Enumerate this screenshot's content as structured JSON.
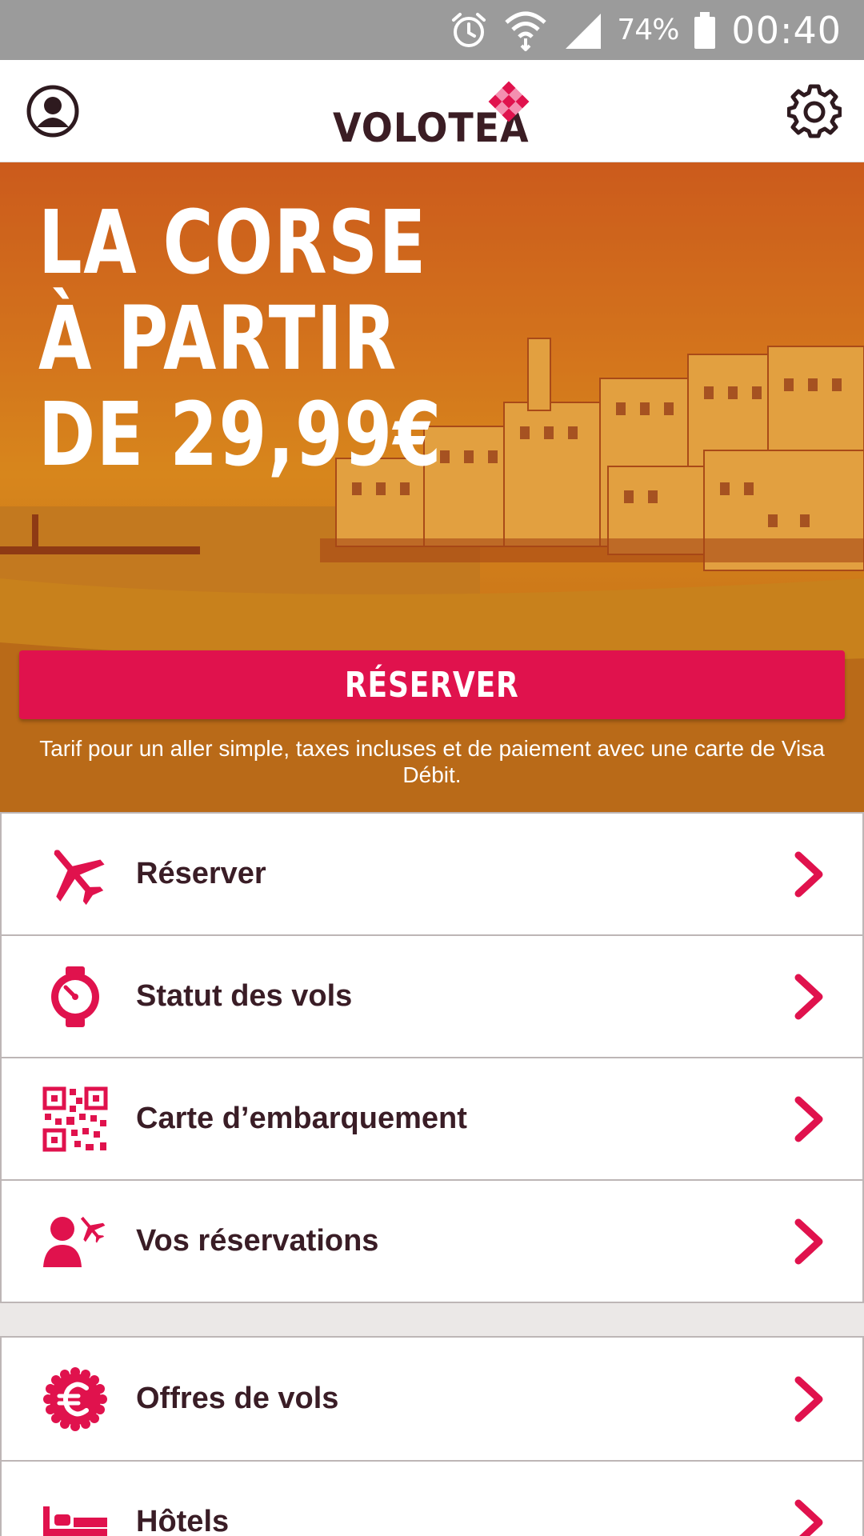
{
  "status_bar": {
    "icons": [
      "alarm-icon",
      "wifi-icon",
      "signal-icon"
    ],
    "battery": "74%",
    "time": "00:40"
  },
  "header": {
    "profile_icon": "account-circle-icon",
    "logo": "VOLOTEA",
    "settings_icon": "gear-icon"
  },
  "hero": {
    "title_lines": [
      "LA CORSE",
      "À PARTIR",
      "DE 29,99€"
    ],
    "cta_label": "RÉSERVER",
    "note": "Tarif pour un aller simple, taxes incluses et de paiement avec une carte de Visa Débit."
  },
  "menu_primary": [
    {
      "label": "Réserver",
      "icon": "airplane-icon"
    },
    {
      "label": "Statut des vols",
      "icon": "stopwatch-icon"
    },
    {
      "label": "Carte d’embarquement",
      "icon": "qr-code-icon"
    },
    {
      "label": "Vos réservations",
      "icon": "passenger-flight-icon"
    }
  ],
  "menu_secondary": [
    {
      "label": "Offres de vols",
      "icon": "euro-badge-icon"
    },
    {
      "label": "Hôtels",
      "icon": "bed-icon"
    }
  ],
  "colors": {
    "accent": "#e0124d",
    "text_dark": "#3a1d26",
    "status_bar": "#9b9b9b"
  }
}
